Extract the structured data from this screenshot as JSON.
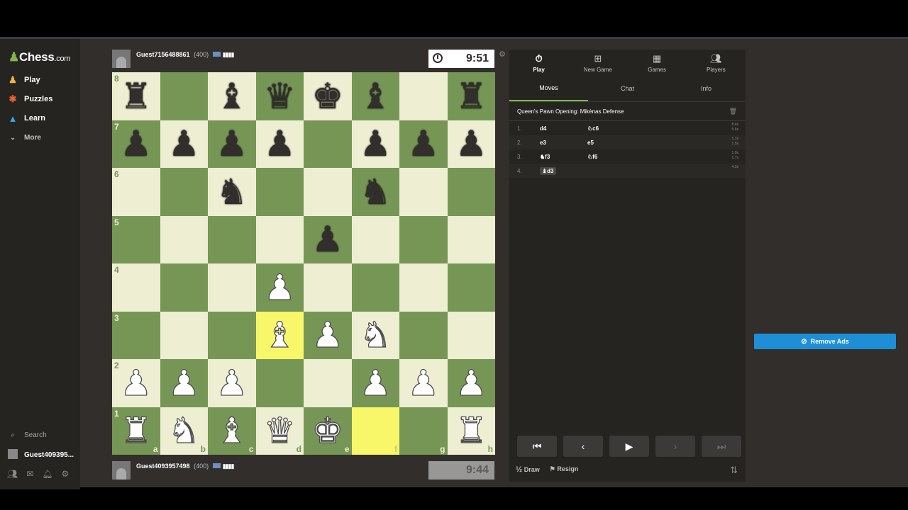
{
  "sidebar": {
    "logo_main": "Chess",
    "logo_suffix": ".com",
    "nav": [
      {
        "label": "Play",
        "icon": "pawn-icon"
      },
      {
        "label": "Puzzles",
        "icon": "puzzle-icon"
      },
      {
        "label": "Learn",
        "icon": "graduation-cap-icon"
      },
      {
        "label": "More",
        "icon": "chevron-down-icon"
      }
    ],
    "search_label": "Search",
    "user_label": "Guest409395..."
  },
  "top_player": {
    "name": "Guest7156488861",
    "rating": "(400)",
    "clock": "9:51"
  },
  "bottom_player": {
    "name": "Guest4093957498",
    "rating": "(400)",
    "clock": "9:44"
  },
  "board": {
    "ranks": [
      "8",
      "7",
      "6",
      "5",
      "4",
      "3",
      "2",
      "1"
    ],
    "files": [
      "a",
      "b",
      "c",
      "d",
      "e",
      "f",
      "g",
      "h"
    ],
    "position": [
      [
        "bR",
        "",
        "bB",
        "bQ",
        "bK",
        "bB",
        "",
        "bR"
      ],
      [
        "bP",
        "bP",
        "bP",
        "bP",
        "",
        "bP",
        "bP",
        "bP"
      ],
      [
        "",
        "",
        "bN",
        "",
        "",
        "bN",
        "",
        ""
      ],
      [
        "",
        "",
        "",
        "",
        "bP",
        "",
        "",
        ""
      ],
      [
        "",
        "",
        "",
        "wP",
        "",
        "",
        "",
        ""
      ],
      [
        "",
        "",
        "",
        "wB",
        "wP",
        "wN",
        "",
        ""
      ],
      [
        "wP",
        "wP",
        "wP",
        "",
        "",
        "wP",
        "wP",
        "wP"
      ],
      [
        "wR",
        "wN",
        "wB",
        "wQ",
        "wK",
        "",
        "",
        "wR"
      ]
    ],
    "highlighted": [
      "d3",
      "f1"
    ]
  },
  "panel": {
    "top_tabs": [
      {
        "label": "Play",
        "icon": "stopwatch-icon",
        "active": true
      },
      {
        "label": "New Game",
        "icon": "plus-square-icon",
        "active": false
      },
      {
        "label": "Games",
        "icon": "board-icon",
        "active": false
      },
      {
        "label": "Players",
        "icon": "players-icon",
        "active": false
      }
    ],
    "sub_tabs": [
      {
        "label": "Moves",
        "active": true
      },
      {
        "label": "Chat",
        "active": false
      },
      {
        "label": "Info",
        "active": false
      }
    ],
    "opening": "Queen's Pawn Opening: Mikėnas Defense",
    "moves": [
      {
        "num": "1.",
        "white": "d4",
        "black": "♘c6",
        "t1": "8.4s",
        "t2": "5.6s"
      },
      {
        "num": "2.",
        "white": "e3",
        "black": "e5",
        "t1": "1.1s",
        "t2": "1.5s"
      },
      {
        "num": "3.",
        "white": "♞f3",
        "black": "♘f6",
        "t1": "1.9s",
        "t2": "1.7s"
      },
      {
        "num": "4.",
        "white": "♝d3",
        "black": "",
        "t1": "4.3s",
        "t2": ""
      }
    ],
    "draw_label": "Draw",
    "resign_label": "Resign",
    "half_label": "½"
  },
  "ads": {
    "remove_label": "Remove Ads"
  }
}
